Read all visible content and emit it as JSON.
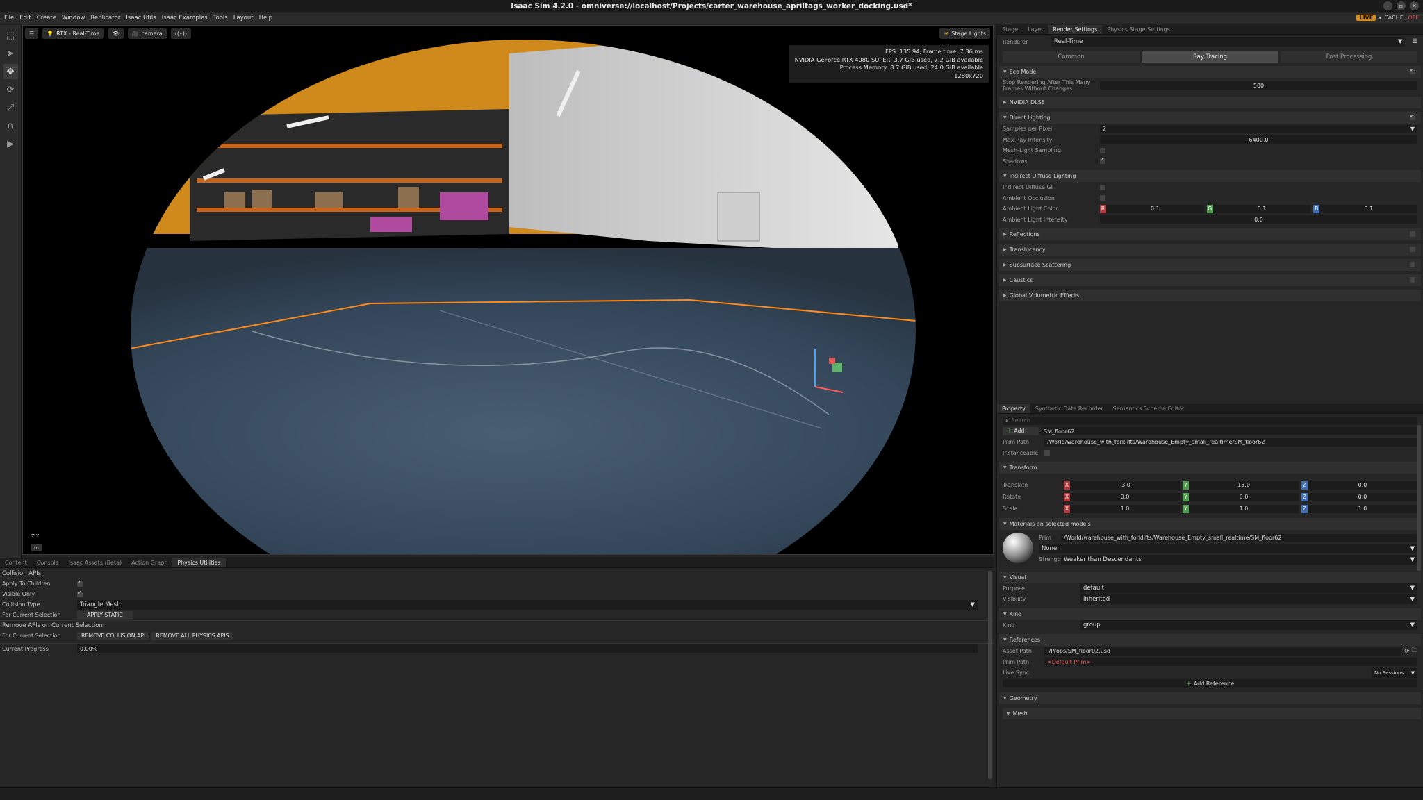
{
  "app": {
    "title": "Isaac Sim 4.2.0 - omniverse://localhost/Projects/carter_warehouse_apriltags_worker_docking.usd*"
  },
  "menu": [
    "File",
    "Edit",
    "Create",
    "Window",
    "Replicator",
    "Isaac Utils",
    "Isaac Examples",
    "Tools",
    "Layout",
    "Help"
  ],
  "status": {
    "live": "LIVE",
    "cache": "CACHE:",
    "cache_state": "OFF"
  },
  "viewport": {
    "render_mode": "RTX - Real-Time",
    "camera": "camera",
    "lights": "Stage Lights",
    "stats": [
      "FPS: 135.94, Frame time: 7.36 ms",
      "NVIDIA GeForce RTX 4080 SUPER: 3.7 GiB used, 7.2 GiB available",
      "Process Memory: 8.7 GiB used, 24.0 GiB available",
      "1280x720"
    ],
    "axis_z": "Z",
    "axis_y": "Y",
    "zoom": "m"
  },
  "render_panel": {
    "tabs": [
      "Stage",
      "Layer",
      "Render Settings",
      "Physics Stage Settings"
    ],
    "renderer_label": "Renderer",
    "renderer_value": "Real-Time",
    "modes": [
      "Common",
      "Ray Tracing",
      "Post Processing"
    ],
    "eco_mode": "Eco Mode",
    "stop_rendering_label": "Stop Rendering After This Many Frames Without Changes",
    "stop_rendering_value": "500",
    "dlss": "NVIDIA DLSS",
    "direct_lighting": "Direct Lighting",
    "samples_label": "Samples per Pixel",
    "samples_value": "2",
    "max_ray_label": "Max Ray Intensity",
    "max_ray_value": "6400.0",
    "mesh_light_label": "Mesh-Light Sampling",
    "shadows_label": "Shadows",
    "indirect": "Indirect Diffuse Lighting",
    "indirect_gi_label": "Indirect Diffuse GI",
    "ao_label": "Ambient Occlusion",
    "ambient_color_label": "Ambient Light Color",
    "ambient_r": "0.1",
    "ambient_g": "0.1",
    "ambient_b": "0.1",
    "ambient_intensity_label": "Ambient Light Intensity",
    "ambient_intensity_value": "0.0",
    "collapsed": [
      "Reflections",
      "Translucency",
      "Subsurface Scattering",
      "Caustics",
      "Global Volumetric Effects"
    ]
  },
  "property_panel": {
    "tabs": [
      "Property",
      "Synthetic Data Recorder",
      "Semantics Schema Editor"
    ],
    "search_placeholder": "Search",
    "add_label": "Add",
    "prim_name": "SM_floor62",
    "prim_path_label": "Prim Path",
    "prim_path": "/World/warehouse_with_forklifts/Warehouse_Empty_small_realtime/SM_floor62",
    "instanceable_label": "Instanceable",
    "transform": "Transform",
    "translate_label": "Translate",
    "translate": [
      "-3.0",
      "15.0",
      "0.0"
    ],
    "rotate_label": "Rotate",
    "rotate": [
      "0.0",
      "0.0",
      "0.0"
    ],
    "scale_label": "Scale",
    "scale": [
      "1.0",
      "1.0",
      "1.0"
    ],
    "materials": "Materials on selected models",
    "mat_prim_label": "Prim",
    "mat_prim": "/World/warehouse_with_forklifts/Warehouse_Empty_small_realtime/SM_floor62",
    "mat_value": "None",
    "strength_label": "Strength",
    "strength_value": "Weaker than Descendants",
    "visual": "Visual",
    "purpose_label": "Purpose",
    "purpose_value": "default",
    "visibility_label": "Visibility",
    "visibility_value": "inherited",
    "kind_section": "Kind",
    "kind_label": "Kind",
    "kind_value": "group",
    "references": "References",
    "asset_path_label": "Asset Path",
    "asset_path": "./Props/SM_floor02.usd",
    "ref_prim_path_label": "Prim Path",
    "ref_prim_path": "<Default Prim>",
    "live_sync_label": "Live Sync",
    "live_sync_value": "No Sessions",
    "add_reference": "Add Reference",
    "geometry": "Geometry",
    "mesh": "Mesh"
  },
  "bottom_panel": {
    "tabs": [
      "Content",
      "Console",
      "Isaac Assets (Beta)",
      "Action Graph",
      "Physics Utilities"
    ],
    "collision_apis": "Collision APIs:",
    "apply_children": "Apply To Children",
    "visible_only": "Visible Only",
    "collision_type_label": "Collision Type",
    "collision_type": "Triangle Mesh",
    "for_selection": "For Current Selection",
    "apply_static": "APPLY STATIC",
    "remove_apis": "Remove APIs on Current Selection:",
    "for_selection2": "For Current Selection",
    "remove_collision": "REMOVE COLLISION API",
    "remove_all": "REMOVE ALL PHYSICS APIS",
    "progress_label": "Current Progress",
    "progress_value": "0.00%"
  }
}
